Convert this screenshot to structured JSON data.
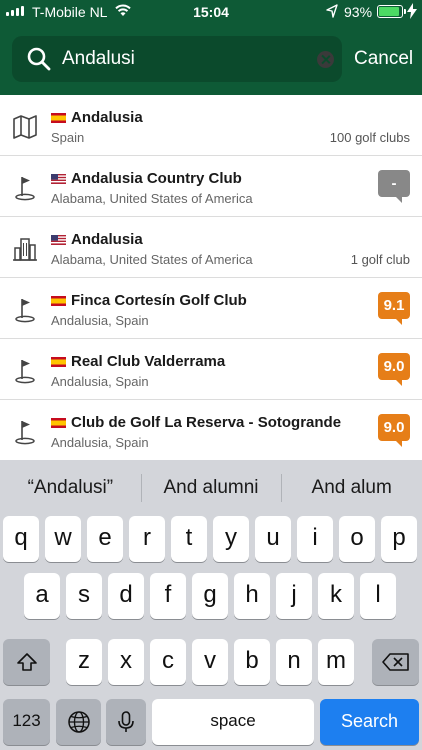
{
  "status_bar": {
    "carrier": "T-Mobile NL",
    "time": "15:04",
    "battery": "93%",
    "battery_level": 0.93,
    "icons": [
      "signal-icon",
      "wifi-icon",
      "location-arrow-icon",
      "battery-icon",
      "charging-bolt-icon"
    ]
  },
  "search": {
    "value": "Andalusi",
    "icon": "search-icon",
    "clear_icon": "clear-icon",
    "cancel_label": "Cancel"
  },
  "results": [
    {
      "icon": "map-icon",
      "flag": "spain",
      "title": "Andalusia",
      "subtitle": "Spain",
      "count": "100 golf clubs"
    },
    {
      "icon": "golf-flag-icon",
      "flag": "usa",
      "title": "Andalusia Country Club",
      "subtitle": "Alabama, United States of America",
      "rating": "-"
    },
    {
      "icon": "city-icon",
      "flag": "usa",
      "title": "Andalusia",
      "subtitle": "Alabama, United States of America",
      "count": "1 golf club"
    },
    {
      "icon": "golf-flag-icon",
      "flag": "spain",
      "title": "Finca Cortesín Golf Club",
      "subtitle": "Andalusia, Spain",
      "rating": "9.1"
    },
    {
      "icon": "golf-flag-icon",
      "flag": "spain",
      "title": "Real Club Valderrama",
      "subtitle": "Andalusia, Spain",
      "rating": "9.0"
    },
    {
      "icon": "golf-flag-icon",
      "flag": "spain",
      "title": "Club de Golf La Reserva - Sotogrande",
      "subtitle": "Andalusia, Spain",
      "rating": "9.0"
    }
  ],
  "keyboard": {
    "suggestions": [
      "“Andalusi”",
      "And alumni",
      "And alum"
    ],
    "row1": [
      "q",
      "w",
      "e",
      "r",
      "t",
      "y",
      "u",
      "i",
      "o",
      "p"
    ],
    "row2": [
      "a",
      "s",
      "d",
      "f",
      "g",
      "h",
      "j",
      "k",
      "l"
    ],
    "row3": [
      "z",
      "x",
      "c",
      "v",
      "b",
      "n",
      "m"
    ],
    "numbers_label": "123",
    "space_label": "space",
    "search_label": "Search"
  },
  "colors": {
    "header": "#0e5a36",
    "search_field": "#0b4a2c",
    "rating_badge": "#e67e18",
    "no_rating_badge": "#888888",
    "keyboard_action": "#1d7ff0"
  }
}
